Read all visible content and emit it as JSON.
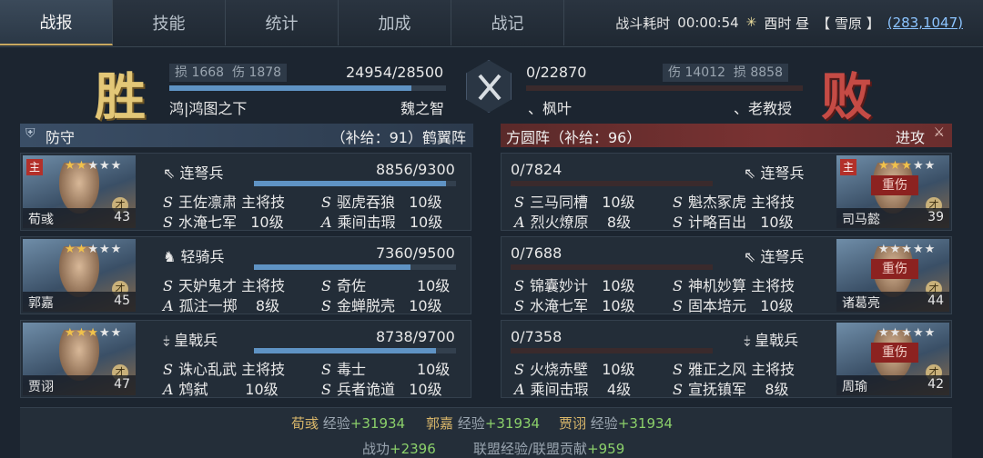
{
  "tabs": [
    "战报",
    "技能",
    "统计",
    "加成",
    "战记"
  ],
  "battle_info": {
    "duration_label": "战斗耗时",
    "duration": "00:00:54",
    "time_label": "酉时 昼",
    "terrain": "【 雪原 】",
    "coordinates": "(283,1047)"
  },
  "result": {
    "victory_text": "胜",
    "defeat_text": "败",
    "left": {
      "loss_label": "损",
      "loss": "1668",
      "damage_label": "伤",
      "damage": "1878",
      "troops": "24954/28500",
      "troops_fraction": 0.8756,
      "alliance": "鸿|鸿图之下",
      "player": "魏之智"
    },
    "right": {
      "loss_label": "损",
      "loss": "8858",
      "damage_label": "伤",
      "damage": "14012",
      "troops": "0/22870",
      "troops_fraction": 0,
      "alliance": "、枫叶",
      "player": "、老教授"
    }
  },
  "left_panel": {
    "stance": "防守",
    "supply": "（补给：91）鹤翼阵"
  },
  "right_panel": {
    "formation": "方圆阵（补给：96）",
    "stance": "进攻"
  },
  "left_generals": [
    {
      "name": "荀彧",
      "level": "43",
      "main": "主",
      "stars": 5,
      "lit_stars": 2,
      "troop_type": "连弩兵",
      "troop_icon": "crossbow-icon",
      "hp": "8856/9300",
      "hp_fraction": 0.952,
      "skills": [
        {
          "grade": "S",
          "name": "王佐凛肃",
          "level": "主将技"
        },
        {
          "grade": "S",
          "name": "驱虎吞狼",
          "level": "10级"
        },
        {
          "grade": "S",
          "name": "水淹七军",
          "level": "10级"
        },
        {
          "grade": "A",
          "name": "乘间击瑕",
          "level": "10级"
        }
      ]
    },
    {
      "name": "郭嘉",
      "level": "45",
      "main": "",
      "stars": 5,
      "lit_stars": 2,
      "troop_type": "轻骑兵",
      "troop_icon": "cavalry-icon",
      "hp": "7360/9500",
      "hp_fraction": 0.775,
      "skills": [
        {
          "grade": "S",
          "name": "天妒鬼才",
          "level": "主将技"
        },
        {
          "grade": "S",
          "name": "奇佐",
          "level": "10级"
        },
        {
          "grade": "A",
          "name": "孤注一掷",
          "level": "8级"
        },
        {
          "grade": "S",
          "name": "金蝉脱壳",
          "level": "10级"
        }
      ]
    },
    {
      "name": "贾诩",
      "level": "47",
      "main": "",
      "stars": 5,
      "lit_stars": 3,
      "troop_type": "皇戟兵",
      "troop_icon": "halberd-icon",
      "hp": "8738/9700",
      "hp_fraction": 0.9,
      "skills": [
        {
          "grade": "S",
          "name": "诛心乱武",
          "level": "主将技"
        },
        {
          "grade": "S",
          "name": "毒士",
          "level": "10级"
        },
        {
          "grade": "A",
          "name": "鸩弑",
          "level": "10级"
        },
        {
          "grade": "S",
          "name": "兵者诡道",
          "level": "10级"
        }
      ]
    }
  ],
  "right_generals": [
    {
      "name": "司马懿",
      "level": "39",
      "main": "主",
      "stars": 5,
      "lit_stars": 3,
      "injured": "重伤",
      "troop_type": "连弩兵",
      "troop_icon": "crossbow-icon",
      "hp": "0/7824",
      "hp_fraction": 0,
      "skills": [
        {
          "grade": "S",
          "name": "三马同槽",
          "level": "10级"
        },
        {
          "grade": "S",
          "name": "魁杰冢虎",
          "level": "主将技"
        },
        {
          "grade": "A",
          "name": "烈火燎原",
          "level": "8级"
        },
        {
          "grade": "S",
          "name": "计略百出",
          "level": "10级"
        }
      ]
    },
    {
      "name": "诸葛亮",
      "level": "44",
      "main": "",
      "stars": 5,
      "lit_stars": 0,
      "injured": "重伤",
      "troop_type": "连弩兵",
      "troop_icon": "crossbow-icon",
      "hp": "0/7688",
      "hp_fraction": 0,
      "skills": [
        {
          "grade": "S",
          "name": "锦囊妙计",
          "level": "10级"
        },
        {
          "grade": "S",
          "name": "神机妙算",
          "level": "主将技"
        },
        {
          "grade": "S",
          "name": "水淹七军",
          "level": "10级"
        },
        {
          "grade": "S",
          "name": "固本培元",
          "level": "10级"
        }
      ]
    },
    {
      "name": "周瑜",
      "level": "42",
      "main": "",
      "stars": 5,
      "lit_stars": 0,
      "injured": "重伤",
      "troop_type": "皇戟兵",
      "troop_icon": "halberd-icon",
      "hp": "0/7358",
      "hp_fraction": 0,
      "skills": [
        {
          "grade": "S",
          "name": "火烧赤壁",
          "level": "10级"
        },
        {
          "grade": "S",
          "name": "雅正之风",
          "level": "主将技"
        },
        {
          "grade": "A",
          "name": "乘间击瑕",
          "level": "4级"
        },
        {
          "grade": "S",
          "name": "宣抚镇军",
          "level": "8级"
        }
      ]
    }
  ],
  "rewards": {
    "exp_label": "经验",
    "exp": [
      {
        "name": "荀彧",
        "value": "+31934"
      },
      {
        "name": "郭嘉",
        "value": "+31934"
      },
      {
        "name": "贾诩",
        "value": "+31934"
      }
    ],
    "merit_label": "战功",
    "merit": "+2396",
    "alliance_label": "联盟经验/联盟贡献",
    "alliance_value": "+959"
  },
  "colors": {
    "accent_gold": "#d8b66a",
    "gain_green": "#8bd06a",
    "defense_blue": "#3a4e66",
    "attack_red": "#7a3232"
  }
}
